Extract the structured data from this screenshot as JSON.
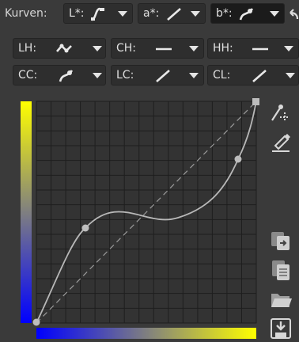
{
  "toolbar": {
    "curves_label": "Kurven:",
    "buttons": [
      {
        "label": "L*:",
        "icon": "film-curve-icon",
        "active": false
      },
      {
        "label": "a*:",
        "icon": "linear-curve-icon",
        "active": false
      },
      {
        "label": "b*:",
        "icon": "custom-curve-icon",
        "active": true
      }
    ],
    "undo_icon": "undo-icon"
  },
  "row2": [
    {
      "label": "LH:",
      "icon": "parametric-curve-icon"
    },
    {
      "label": "CH:",
      "icon": "flat-curve-icon"
    },
    {
      "label": "HH:",
      "icon": "flat-curve-icon"
    }
  ],
  "row3": [
    {
      "label": "CC:",
      "icon": "custom-curve-icon"
    },
    {
      "label": "LC:",
      "icon": "linear-curve-icon"
    },
    {
      "label": "CL:",
      "icon": "linear-curve-icon"
    }
  ],
  "side_tools": [
    "edit-point-icon",
    "pipette-icon",
    "paste-icon",
    "copy-icon",
    "open-folder-icon",
    "save-icon"
  ],
  "colors": {
    "background": "#3a3a3a",
    "graph_bg": "#333333",
    "grid": "#1e1e1e",
    "curve": "#b8b8b8",
    "control_point": "#bdbdbd",
    "gradient_low": "#0000ff",
    "gradient_high": "#ffff00"
  }
}
